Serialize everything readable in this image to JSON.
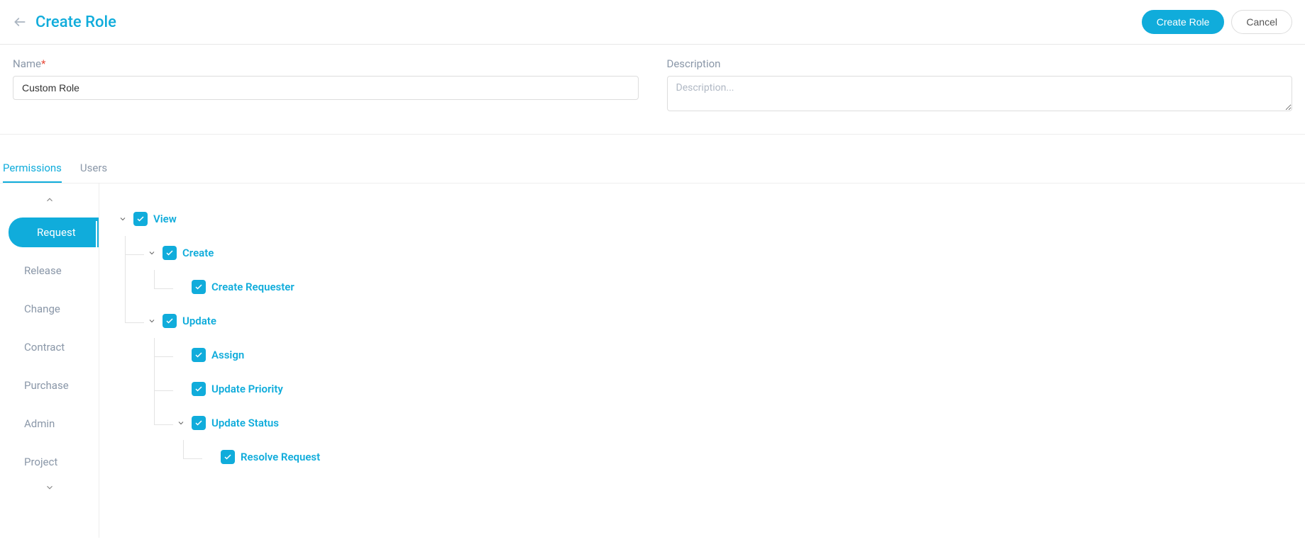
{
  "header": {
    "title": "Create Role",
    "create_btn": "Create Role",
    "cancel_btn": "Cancel"
  },
  "form": {
    "name_label": "Name",
    "name_value": "Custom Role",
    "desc_label": "Description",
    "desc_placeholder": "Description...",
    "desc_value": ""
  },
  "tabs": [
    {
      "id": "permissions",
      "label": "Permissions",
      "active": true
    },
    {
      "id": "users",
      "label": "Users",
      "active": false
    }
  ],
  "sidebar": {
    "items": [
      {
        "id": "request",
        "label": "Request",
        "active": true
      },
      {
        "id": "release",
        "label": "Release",
        "active": false
      },
      {
        "id": "change",
        "label": "Change",
        "active": false
      },
      {
        "id": "contract",
        "label": "Contract",
        "active": false
      },
      {
        "id": "purchase",
        "label": "Purchase",
        "active": false
      },
      {
        "id": "admin",
        "label": "Admin",
        "active": false
      },
      {
        "id": "project",
        "label": "Project",
        "active": false
      }
    ]
  },
  "permissions": {
    "view": {
      "label": "View",
      "checked": true,
      "expandable": true,
      "create": {
        "label": "Create",
        "checked": true,
        "expandable": true,
        "create_requester": {
          "label": "Create Requester",
          "checked": true,
          "expandable": false
        }
      },
      "update": {
        "label": "Update",
        "checked": true,
        "expandable": true,
        "assign": {
          "label": "Assign",
          "checked": true,
          "expandable": false
        },
        "update_priority": {
          "label": "Update Priority",
          "checked": true,
          "expandable": false
        },
        "update_status": {
          "label": "Update Status",
          "checked": true,
          "expandable": true,
          "resolve_request": {
            "label": "Resolve Request",
            "checked": true,
            "expandable": false
          }
        }
      }
    }
  }
}
